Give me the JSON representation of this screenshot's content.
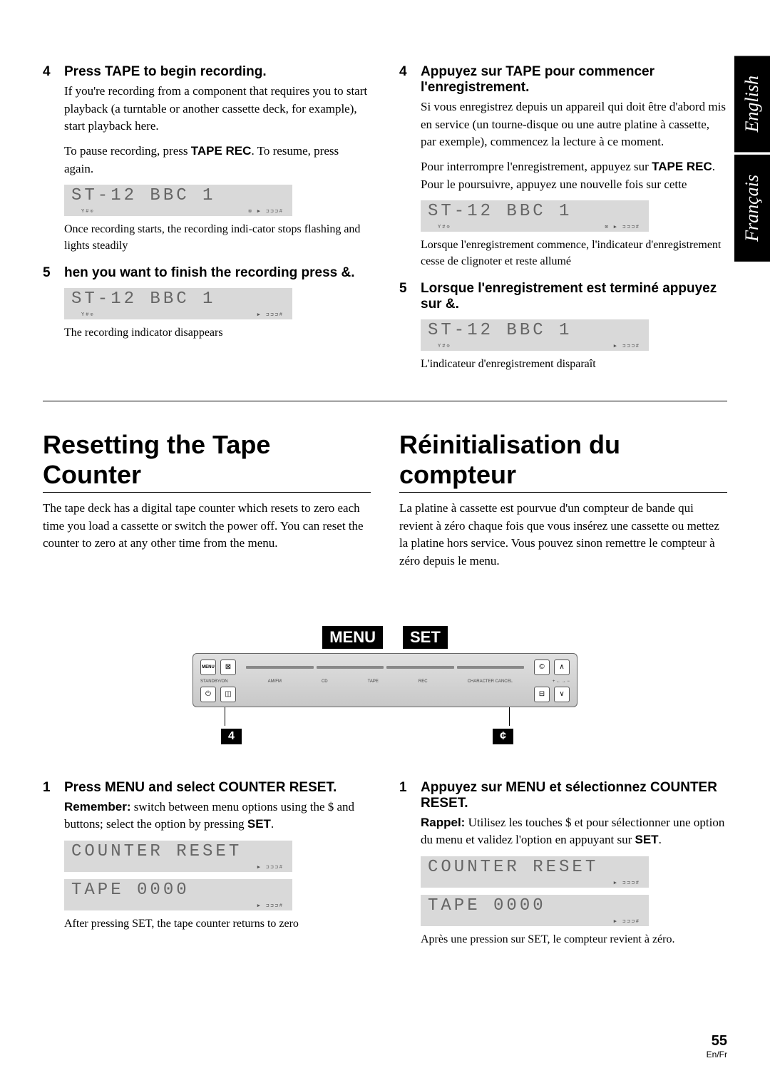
{
  "langTabs": {
    "english": "English",
    "francais": "Français"
  },
  "left": {
    "step4": {
      "num": "4",
      "title": "Press TAPE to begin recording.",
      "body1": "If you're recording from a component that requires you to start playback (a turntable or another cassette deck, for example), start playback here.",
      "body2a": "To pause recording, press ",
      "body2b": "TAPE REC",
      "body2c": ". To resume, press again.",
      "lcd": "ST-12 BBC 1",
      "caption": "Once recording starts, the recording indi-cator stops flashing and lights steadily"
    },
    "step5": {
      "num": "5",
      "title": "hen you want to finish the recording press &.",
      "lcd": "ST-12 BBC 1",
      "caption": "The recording indicator disappears"
    },
    "section2": {
      "title": "Resetting the Tape Counter",
      "intro": "The tape deck has a digital tape counter which resets to zero each time you load a cassette or switch the power off. You can reset the counter to zero at any other time from the menu."
    },
    "step1b": {
      "num": "1",
      "title": "Press MENU and select COUNTER RESET.",
      "remLabel": "Remember:",
      "rem1": " switch between menu options using the $ and          buttons; select the option by pressing ",
      "rem2": "SET",
      "rem3": ".",
      "lcd1": "COUNTER RESET",
      "lcd2": "TAPE  0000",
      "caption": "After pressing SET, the tape counter returns to zero"
    }
  },
  "right": {
    "step4": {
      "num": "4",
      "title": "Appuyez sur TAPE pour commencer l'enregistrement.",
      "body1": "Si vous enregistrez depuis un appareil qui doit être d'abord mis en service (un tourne-disque ou une autre platine à cassette, par exemple), commencez la lecture à ce moment.",
      "body2a": "Pour interrompre l'enregistrement, appuyez sur ",
      "body2b": "TAPE REC",
      "body2c": ". Pour le poursuivre, appuyez une nouvelle fois sur cette",
      "lcd": "ST-12 BBC 1",
      "caption": "Lorsque l'enregistrement commence, l'indicateur d'enregistrement cesse de clignoter et reste allumé"
    },
    "step5": {
      "num": "5",
      "title": "Lorsque l'enregistrement est terminé appuyez sur &.",
      "lcd": "ST-12 BBC 1",
      "caption": "L'indicateur d'enregistrement disparaît"
    },
    "section2": {
      "title": "Réinitialisation du compteur",
      "intro": "La platine à cassette est pourvue d'un compteur de bande qui revient à zéro chaque fois que vous insérez une cassette ou mettez la platine hors service. Vous pouvez sinon remettre le compteur à zéro depuis le menu."
    },
    "step1b": {
      "num": "1",
      "title": "Appuyez sur MENU et sélectionnez COUNTER RESET.",
      "remLabel": "Rappel:",
      "rem1": " Utilisez les touches $          et          pour sélectionner une option du menu et validez l'option en appuyant sur ",
      "rem2": "SET",
      "rem3": ".",
      "lcd1": "COUNTER RESET",
      "lcd2": "TAPE  0000",
      "caption": "Après une pression sur SET, le compteur revient à zéro."
    }
  },
  "menuSet": {
    "menu": "MENU",
    "set": "SET"
  },
  "device": {
    "label4": "4",
    "labelC": "¢"
  },
  "footer": {
    "page": "55",
    "lang": "En/Fr"
  }
}
